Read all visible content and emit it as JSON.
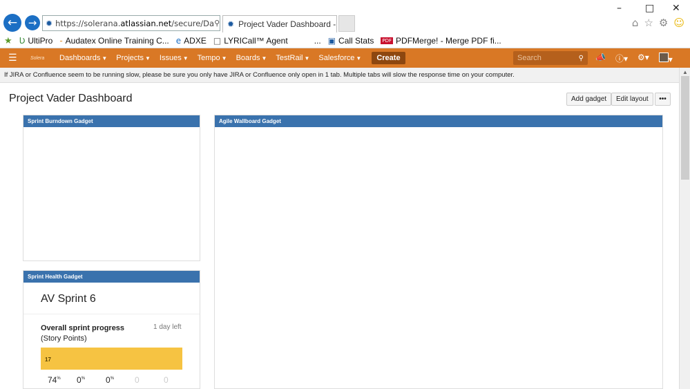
{
  "browser": {
    "url_prefix": "https://solerana.",
    "url_domain": "atlassian.net",
    "url_path": "/secure/Da",
    "tab_title": "Project Vader Dashboard - S...",
    "tab_close": "×",
    "favorites": [
      {
        "icon": "ultipro-icon",
        "glyph": "Ʋ",
        "label": "UltiPro"
      },
      {
        "icon": "audatex-icon",
        "glyph": "-",
        "label": "Audatex Online Training C..."
      },
      {
        "icon": "ie-icon",
        "glyph": "e",
        "label": "ADXE"
      },
      {
        "icon": "page-icon",
        "glyph": "□",
        "label": "LYRICall™ Agent"
      },
      {
        "icon": "more-icon",
        "glyph": "",
        "label": "..."
      },
      {
        "icon": "callstats-icon",
        "glyph": "▣",
        "label": "Call Stats"
      },
      {
        "icon": "pdf-icon",
        "glyph": "PDF",
        "label": "PDFMerge! - Merge PDF fi..."
      }
    ]
  },
  "jira": {
    "logo": "Solera",
    "menu": [
      "Dashboards",
      "Projects",
      "Issues",
      "Tempo",
      "Boards",
      "TestRail",
      "Salesforce"
    ],
    "create_label": "Create",
    "search_placeholder": "Search",
    "notice": "If JIRA or Confluence seem to be running slow, please be sure you only have JIRA or Confluence only open in 1 tab. Multiple tabs will slow the response time on your computer."
  },
  "dashboard": {
    "title": "Project Vader Dashboard",
    "add_gadget_label": "Add gadget",
    "edit_layout_label": "Edit layout",
    "more_label": "•••"
  },
  "gadgets": {
    "burndown_title": "Sprint Burndown Gadget",
    "wallboard_title": "Agile Wallboard Gadget",
    "health_title": "Sprint Health Gadget"
  },
  "sprint_health": {
    "sprint_name": "AV Sprint 6",
    "progress_label_bold": "Overall sprint progress",
    "progress_label_rest": " (Story Points)",
    "days_left": "1 day left",
    "progress_value": "17",
    "progress_fraction": 1.0,
    "stats": [
      {
        "value": "74",
        "unit": "%"
      },
      {
        "value": "0",
        "unit": "%"
      },
      {
        "value": "0",
        "unit": "%"
      },
      {
        "value": "0",
        "unit": ""
      },
      {
        "value": "0",
        "unit": ""
      }
    ]
  },
  "colors": {
    "header": "#d97825",
    "gadget_title": "#3a72ad",
    "progress": "#f6c342"
  }
}
